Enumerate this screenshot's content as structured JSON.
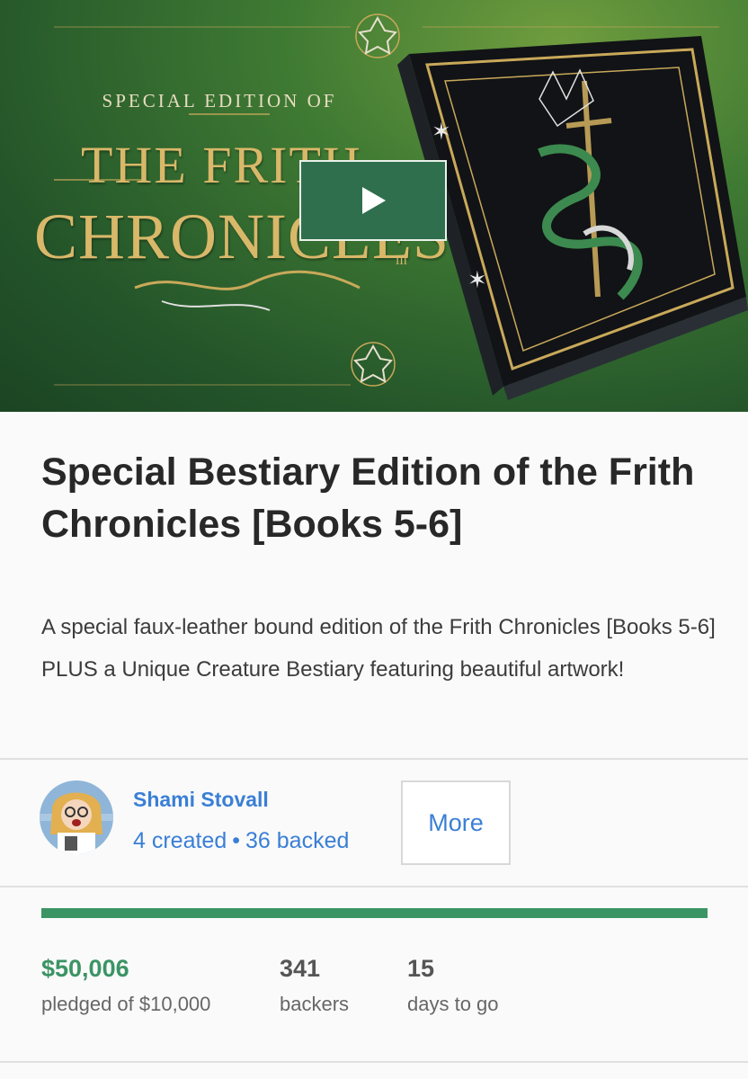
{
  "hero": {
    "small_caption": "SPECIAL EDITION OF",
    "title_line1": "THE FRITH",
    "title_line2": "CHRONICLES",
    "volume_mark": "III"
  },
  "project": {
    "title": "Special Bestiary Edition of the Frith Chronicles [Books 5-6]",
    "blurb": "A special faux-leather bound edition of the Frith Chronicles [Books 5-6] PLUS a Unique Creature Bestiary featuring beautiful artwork!"
  },
  "creator": {
    "name": "Shami Stovall",
    "created": "4 created",
    "separator": "•",
    "backed": "36 backed",
    "more_label": "More"
  },
  "funding": {
    "progress": 1.0,
    "pledged": "$50,006",
    "pledged_label": "pledged of $10,000",
    "backers": "341",
    "backers_label": "backers",
    "days": "15",
    "days_label": "days to go"
  },
  "colors": {
    "accent_green": "#3b9464",
    "link_blue": "#3a7fd5",
    "play_button": "#2f6f4e"
  },
  "icons": {
    "play": "play-icon",
    "star": "heptagram-icon"
  }
}
